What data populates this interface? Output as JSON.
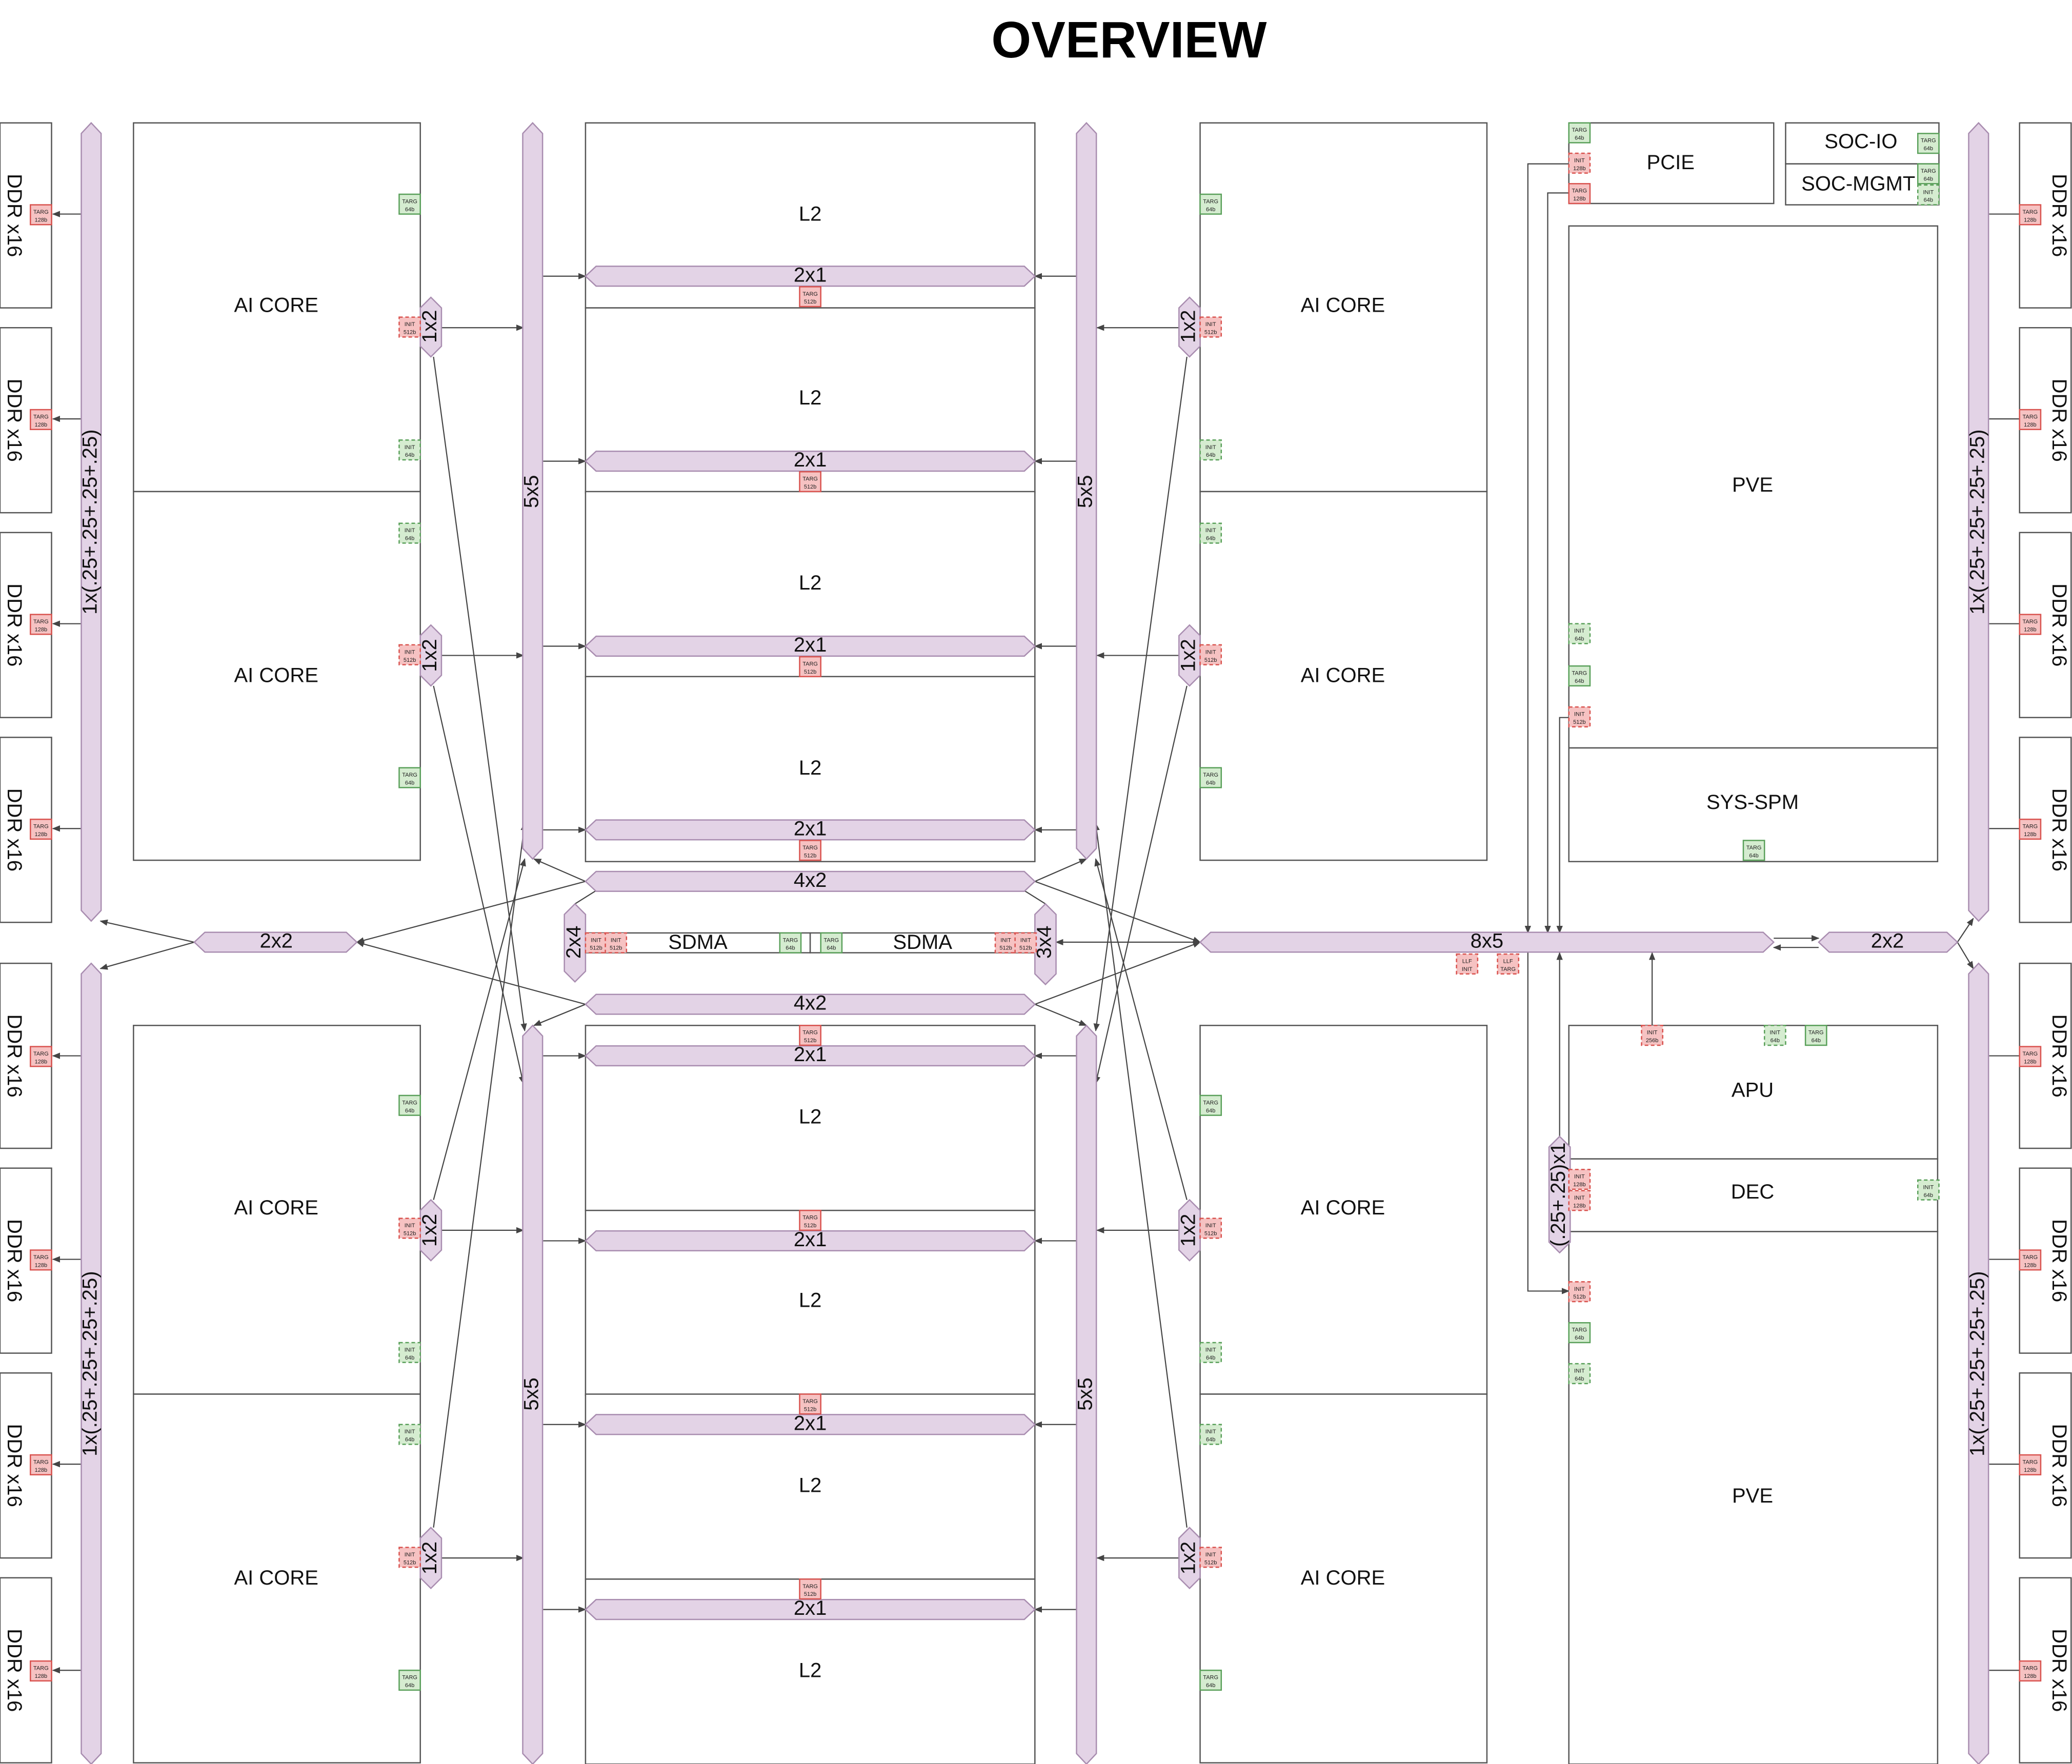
{
  "title": "OVERVIEW",
  "blocks": [
    {
      "label": "AI CORE"
    },
    {
      "label": "AI CORE"
    },
    {
      "label": "AI CORE"
    },
    {
      "label": "AI CORE"
    },
    {
      "label": "AI CORE"
    },
    {
      "label": "AI CORE"
    },
    {
      "label": "AI CORE"
    },
    {
      "label": "AI CORE"
    },
    {
      "label": "L2"
    },
    {
      "label": "L2"
    },
    {
      "label": "L2"
    },
    {
      "label": "L2"
    },
    {
      "label": "L2"
    },
    {
      "label": "L2"
    },
    {
      "label": "L2"
    },
    {
      "label": "L2"
    },
    {
      "label": "PCIE"
    },
    {
      "label": "SOC-IO"
    },
    {
      "label": "SOC-MGMT"
    },
    {
      "label": "PVE"
    },
    {
      "label": "SYS-SPM"
    },
    {
      "label": "APU"
    },
    {
      "label": "DEC"
    },
    {
      "label": "PVE"
    }
  ],
  "ddr": [
    {
      "label": "DDR x16"
    },
    {
      "label": "DDR x16"
    },
    {
      "label": "DDR x16"
    },
    {
      "label": "DDR x16"
    },
    {
      "label": "DDR x16"
    },
    {
      "label": "DDR x16"
    },
    {
      "label": "DDR x16"
    },
    {
      "label": "DDR x16"
    },
    {
      "label": "DDR x16"
    },
    {
      "label": "DDR x16"
    },
    {
      "label": "DDR x16"
    },
    {
      "label": "DDR x16"
    },
    {
      "label": "DDR x16"
    },
    {
      "label": "DDR x16"
    },
    {
      "label": "DDR x16"
    },
    {
      "label": "DDR x16"
    }
  ],
  "buses": [
    {
      "label": "1x(.25+.25+.25+.25)"
    },
    {
      "label": "1x(.25+.25+.25+.25)"
    },
    {
      "label": "1x(.25+.25+.25+.25)"
    },
    {
      "label": "1x(.25+.25+.25+.25)"
    },
    {
      "label": "5x5"
    },
    {
      "label": "5x5"
    },
    {
      "label": "5x5"
    },
    {
      "label": "5x5"
    },
    {
      "label": "2x1"
    },
    {
      "label": "2x1"
    },
    {
      "label": "2x1"
    },
    {
      "label": "2x1"
    },
    {
      "label": "2x1"
    },
    {
      "label": "2x1"
    },
    {
      "label": "2x1"
    },
    {
      "label": "2x1"
    },
    {
      "label": "4x2"
    },
    {
      "label": "4x2"
    },
    {
      "label": "2x2"
    },
    {
      "label": "2x2"
    },
    {
      "label": "8x5"
    },
    {
      "label": "2x4"
    },
    {
      "label": "3x4"
    },
    {
      "label": "1x2"
    },
    {
      "label": "1x2"
    },
    {
      "label": "1x2"
    },
    {
      "label": "1x2"
    },
    {
      "label": "1x2"
    },
    {
      "label": "1x2"
    },
    {
      "label": "1x2"
    },
    {
      "label": "1x2"
    },
    {
      "label": "(.25+.25)x1"
    }
  ],
  "sdma": [
    {
      "label": "SDMA"
    },
    {
      "label": "SDMA"
    }
  ],
  "ports": {
    "targ_128b": [
      "TARG",
      "128b"
    ],
    "targ_512b": [
      "TARG",
      "512b"
    ],
    "targ_64b": [
      "TARG",
      "64b"
    ],
    "init_512b": [
      "INIT",
      "512b"
    ],
    "init_64b": [
      "INIT",
      "64b"
    ],
    "init_128b": [
      "INIT",
      "128b"
    ],
    "init_256b": [
      "INIT",
      "256b"
    ],
    "llf_init": [
      "LLF",
      "INIT"
    ],
    "llf_targ": [
      "LLF",
      "TARG"
    ]
  },
  "colors": {
    "bus_fill": "#e3d3e6",
    "bus_stroke": "#a98db0",
    "targ_red_fill": "#f6c2c2",
    "port_red_stroke": "#d9534f",
    "port_green_fill": "#d5ecd0",
    "port_green_stroke": "#5aa05a"
  }
}
